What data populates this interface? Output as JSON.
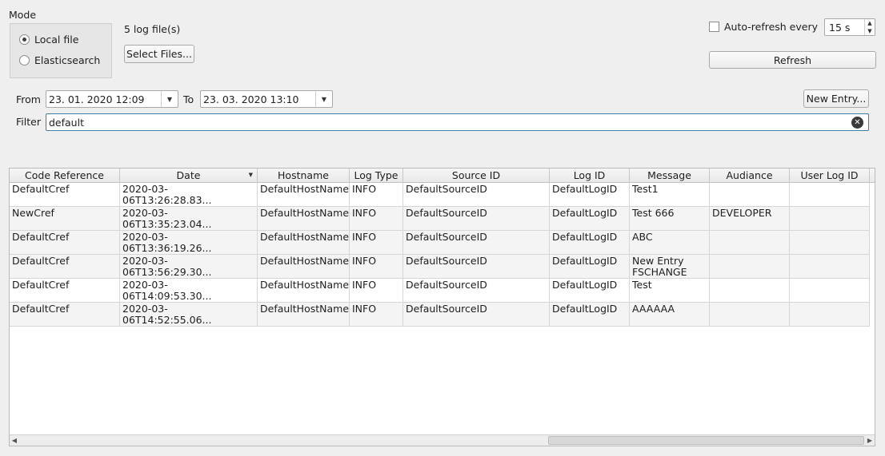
{
  "mode": {
    "title": "Mode",
    "options": [
      "Local file",
      "Elasticsearch"
    ],
    "selected": "Local file"
  },
  "files": {
    "count_text": "5 log file(s)",
    "select_label": "Select Files..."
  },
  "refresh": {
    "auto_label": "Auto-refresh every",
    "auto_checked": false,
    "interval": "15 s",
    "refresh_label": "Refresh"
  },
  "range": {
    "from_label": "From",
    "from_value": "23. 01. 2020 12:09",
    "to_label": "To",
    "to_value": "23. 03. 2020 13:10",
    "new_entry_label": "New Entry..."
  },
  "filter": {
    "label": "Filter",
    "value": "default"
  },
  "table": {
    "columns": [
      "Code Reference",
      "Date",
      "Hostname",
      "Log Type",
      "Source ID",
      "Log ID",
      "Message",
      "Audiance",
      "User Log ID"
    ],
    "rows": [
      [
        "DefaultCref",
        "2020-03-06T13:26:28.83...",
        "DefaultHostName",
        "INFO",
        "DefaultSourceID",
        "DefaultLogID",
        "Test1",
        "",
        ""
      ],
      [
        "NewCref",
        "2020-03-06T13:35:23.04...",
        "DefaultHostName",
        "INFO",
        "DefaultSourceID",
        "DefaultLogID",
        "Test 666",
        "DEVELOPER",
        ""
      ],
      [
        "DefaultCref",
        "2020-03-06T13:36:19.26...",
        "DefaultHostName",
        "INFO",
        "DefaultSourceID",
        "DefaultLogID",
        "ABC",
        "",
        ""
      ],
      [
        "DefaultCref",
        "2020-03-06T13:56:29.30...",
        "DefaultHostName",
        "INFO",
        "DefaultSourceID",
        "DefaultLogID",
        "New Entry\nFSCHANGE",
        "",
        ""
      ],
      [
        "DefaultCref",
        "2020-03-06T14:09:53.30...",
        "DefaultHostName",
        "INFO",
        "DefaultSourceID",
        "DefaultLogID",
        "Test",
        "",
        ""
      ],
      [
        "DefaultCref",
        "2020-03-06T14:52:55.06...",
        "DefaultHostName",
        "INFO",
        "DefaultSourceID",
        "DefaultLogID",
        "AAAAAA",
        "",
        ""
      ]
    ]
  },
  "colors": {
    "accent": "#3d7eaa",
    "background": "#efefef"
  }
}
